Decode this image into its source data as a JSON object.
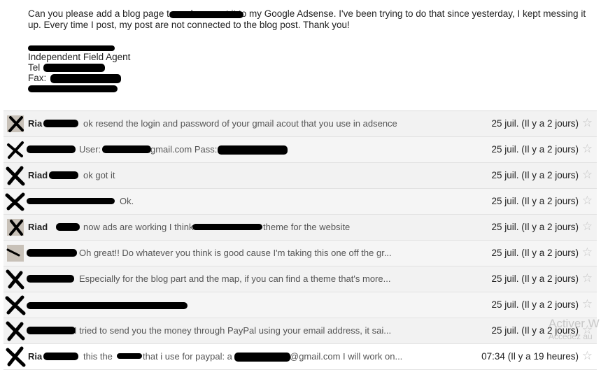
{
  "email": {
    "body_text": "Can you please add a blog page to                    and connect it to my Google Adsense. I've been trying to do that since yesterday, I kept messing it up. Every time I post, my post are not connected to the blog post. Thank you!",
    "signature": {
      "title": "Independent Field Agent",
      "tel_label": "Tel",
      "fax_label": "Fax:"
    }
  },
  "thread": {
    "rows": [
      {
        "sender": "Ria",
        "snippet": "ok resend the login and password of your gmail acout that you use in adsence",
        "date": "25 juil. (Il y a 2 jours)"
      },
      {
        "sender": "",
        "snippet": "User:",
        "snippet2": "gmail.com Pass:",
        "snippet3": "",
        "date": "25 juil. (Il y a 2 jours)"
      },
      {
        "sender": "Riad",
        "snippet": "ok got it",
        "date": "25 juil. (Il y a 2 jours)"
      },
      {
        "sender": "",
        "snippet": "Ok.",
        "date": "25 juil. (Il y a 2 jours)"
      },
      {
        "sender": "Riad",
        "snippet": "now ads are working I think",
        "snippet2": "theme for the website",
        "date": "25 juil. (Il y a 2 jours)"
      },
      {
        "sender": "",
        "snippet": "Oh great!! Do whatever you think is good cause I'm taking this one off the gr...",
        "date": "25 juil. (Il y a 2 jours)"
      },
      {
        "sender": "",
        "snippet": "Especially for the blog part and the map, if you can find a theme that's more...",
        "date": "25 juil. (Il y a 2 jours)"
      },
      {
        "sender": "",
        "snippet": "",
        "date": "25 juil. (Il y a 2 jours)"
      },
      {
        "sender": "",
        "snippet": "I tried to send you the money through PayPal using your email address, it sai...",
        "date": "25 juil. (Il y a 2 jours)"
      },
      {
        "sender": "Ria",
        "snippet": "this the",
        "snippet2": "that i use for paypal: a",
        "snippet3": "@gmail.com I will work on...",
        "date": "07:34 (Il y a 19 heures)"
      }
    ]
  },
  "watermark": {
    "line1": "Activer W",
    "line2": "Accédez au"
  },
  "icons": {
    "star": "star-icon",
    "avatar": "avatar"
  },
  "colors": {
    "row_bg": "#f2f2f2",
    "star": "#c6c6c6",
    "redaction": "#000000"
  }
}
